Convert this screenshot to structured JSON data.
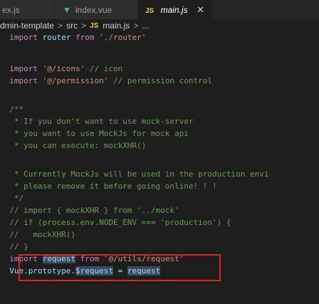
{
  "tabs": [
    {
      "label": "ex.js",
      "icon": "",
      "active": false
    },
    {
      "label": "index.vue",
      "icon": "vue-icon",
      "active": false
    },
    {
      "label": "main.js",
      "icon": "js-icon",
      "icon_text": "JS",
      "active": true
    }
  ],
  "vue_icon_glyph": "▼",
  "close_glyph": "✕",
  "breadcrumb": {
    "parts": [
      "dmin-template",
      "src",
      "main.js",
      "..."
    ],
    "separator": ">",
    "file_icon_text": "JS"
  },
  "code_lines": [
    "  import router from './router'",
    "",
    "  import '@/icons' // icon",
    "  import '@/permission' // permission control",
    "",
    "  /**",
    "   * If you don't want to use mock-server",
    "   * you want to use MockJs for mock api",
    "   * you can execute: mockXHR()",
    "",
    "   * Currently MockJs will be used in the production envi",
    "   * please remove it before going online! ! !",
    "   */",
    "  // import { mockXHR } from '../mock'",
    "  // if (process.env.NODE_ENV === 'production') {",
    "  //   mockXHR()",
    "  // }",
    "  import request from '@/utils/request'",
    "  Vue.prototype.$request = request"
  ],
  "colors": {
    "keyword": "#c586c0",
    "string": "#ce9178",
    "comment": "#6a9955",
    "identifier": "#9cdcfe",
    "highlight_border": "#e0221f"
  }
}
